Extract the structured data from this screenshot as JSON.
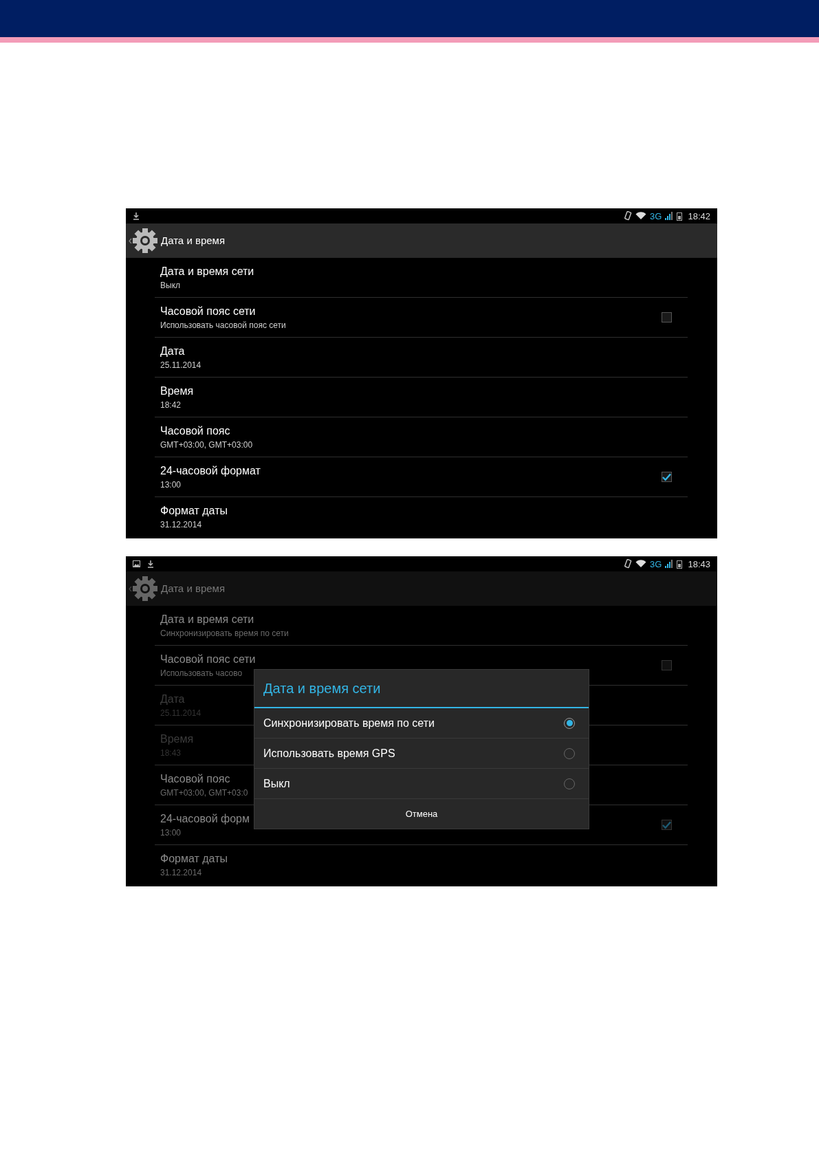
{
  "screens": [
    {
      "dimmed": false,
      "status_bar": {
        "notification_icons": [
          {
            "kind": "download"
          }
        ],
        "network": "3G",
        "time": "18:42"
      },
      "action_bar": {
        "title": "Дата и время"
      },
      "items": [
        {
          "kind": "plain",
          "title": "Дата и время сети",
          "summary": "Выкл",
          "disabled": false
        },
        {
          "kind": "checkbox",
          "title": "Часовой пояс сети",
          "summary": "Использовать часовой пояс сети",
          "disabled": false,
          "checked": false
        },
        {
          "kind": "plain",
          "title": "Дата",
          "summary": "25.11.2014",
          "disabled": false
        },
        {
          "kind": "plain",
          "title": "Время",
          "summary": "18:42",
          "disabled": false
        },
        {
          "kind": "plain",
          "title": "Часовой пояс",
          "summary": "GMT+03:00, GMT+03:00",
          "disabled": false
        },
        {
          "kind": "checkbox",
          "title": "24-часовой формат",
          "summary": "13:00",
          "disabled": false,
          "checked": true
        },
        {
          "kind": "plain",
          "title": "Формат даты",
          "summary": "31.12.2014",
          "disabled": false
        }
      ]
    },
    {
      "dimmed": true,
      "status_bar": {
        "notification_icons": [
          {
            "kind": "image"
          },
          {
            "kind": "download"
          }
        ],
        "network": "3G",
        "time": "18:43"
      },
      "action_bar": {
        "title": "Дата и время"
      },
      "items": [
        {
          "kind": "plain",
          "title": "Дата и время сети",
          "summary": "Синхронизировать время по сети",
          "disabled": false
        },
        {
          "kind": "checkbox",
          "title": "Часовой пояс сети",
          "summary": "Использовать часово",
          "disabled": false,
          "checked": false
        },
        {
          "kind": "plain",
          "title": "Дата",
          "summary": "25.11.2014",
          "disabled": true
        },
        {
          "kind": "plain",
          "title": "Время",
          "summary": "18:43",
          "disabled": true
        },
        {
          "kind": "plain",
          "title": "Часовой пояс",
          "summary": "GMT+03:00, GMT+03:0",
          "disabled": false
        },
        {
          "kind": "checkbox",
          "title": "24-часовой форм",
          "summary": "13:00",
          "disabled": false,
          "checked": true
        },
        {
          "kind": "plain",
          "title": "Формат даты",
          "summary": "31.12.2014",
          "disabled": false
        }
      ],
      "dialog": {
        "title": "Дата и время сети",
        "options": [
          {
            "label": "Синхронизировать время по сети",
            "selected": true
          },
          {
            "label": "Использовать время GPS",
            "selected": false
          },
          {
            "label": "Выкл",
            "selected": false
          }
        ],
        "cancel": "Отмена"
      }
    }
  ]
}
